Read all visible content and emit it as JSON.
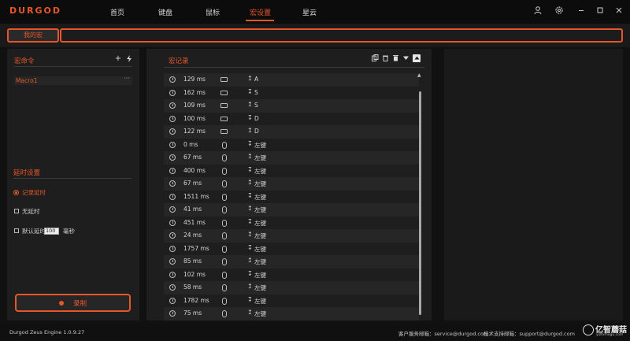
{
  "app": {
    "logo": "DURGOD",
    "nav": [
      {
        "label": "首页",
        "active": false
      },
      {
        "label": "键盘",
        "active": false
      },
      {
        "label": "鼠标",
        "active": false
      },
      {
        "label": "宏设置",
        "active": true
      },
      {
        "label": "星云",
        "active": false
      }
    ],
    "window_icons": [
      "user-icon",
      "settings-icon",
      "minimize-icon",
      "maximize-icon",
      "close-icon"
    ],
    "accent_color": "#e5572a"
  },
  "tabs": {
    "my_macro_label": "我的宏",
    "tab_field_value": ""
  },
  "left": {
    "commands_title": "宏命令",
    "add_label": "+",
    "macros": [
      {
        "name": "Macro1",
        "menu": "···"
      }
    ],
    "delay_title": "延时设置",
    "options": {
      "record_delay": "记录延时",
      "no_delay": "无延时",
      "default_delay": "默认延时",
      "default_delay_value": "100",
      "default_delay_unit": "毫秒"
    },
    "record_button": "录制"
  },
  "main": {
    "title": "宏记录",
    "toolbar_icons": [
      "copy-icon",
      "delete-icon",
      "clear-icon",
      "move-down-icon",
      "move-up-icon"
    ],
    "events": [
      {
        "delay": "129 ms",
        "device": "keyboard",
        "action": "up",
        "key": "A"
      },
      {
        "delay": "162 ms",
        "device": "keyboard",
        "action": "down",
        "key": "S"
      },
      {
        "delay": "109 ms",
        "device": "keyboard",
        "action": "up",
        "key": "S"
      },
      {
        "delay": "100 ms",
        "device": "keyboard",
        "action": "down",
        "key": "D"
      },
      {
        "delay": "122 ms",
        "device": "keyboard",
        "action": "up",
        "key": "D"
      },
      {
        "delay": "0 ms",
        "device": "mouse",
        "action": "down",
        "key": "左键"
      },
      {
        "delay": "67 ms",
        "device": "mouse",
        "action": "up",
        "key": "左键"
      },
      {
        "delay": "400 ms",
        "device": "mouse",
        "action": "down",
        "key": "左键"
      },
      {
        "delay": "67 ms",
        "device": "mouse",
        "action": "up",
        "key": "左键"
      },
      {
        "delay": "1511 ms",
        "device": "mouse",
        "action": "down",
        "key": "左键"
      },
      {
        "delay": "41 ms",
        "device": "mouse",
        "action": "up",
        "key": "左键"
      },
      {
        "delay": "451 ms",
        "device": "mouse",
        "action": "down",
        "key": "左键"
      },
      {
        "delay": "24 ms",
        "device": "mouse",
        "action": "up",
        "key": "左键"
      },
      {
        "delay": "1757 ms",
        "device": "mouse",
        "action": "down",
        "key": "左键"
      },
      {
        "delay": "85 ms",
        "device": "mouse",
        "action": "up",
        "key": "左键"
      },
      {
        "delay": "102 ms",
        "device": "mouse",
        "action": "down",
        "key": "左键"
      },
      {
        "delay": "58 ms",
        "device": "mouse",
        "action": "up",
        "key": "左键"
      },
      {
        "delay": "1782 ms",
        "device": "mouse",
        "action": "down",
        "key": "左键"
      },
      {
        "delay": "75 ms",
        "device": "mouse",
        "action": "up",
        "key": "左键"
      }
    ]
  },
  "footer": {
    "version": "Durgod Zeus Engine 1.0.9.27",
    "service": "客户服务邮箱：service@durgod.com",
    "support": "技术支持邮箱：support@durgod.com"
  },
  "watermark": {
    "text": "亿智蘑菇",
    "sub": "yizhimogu.com"
  }
}
